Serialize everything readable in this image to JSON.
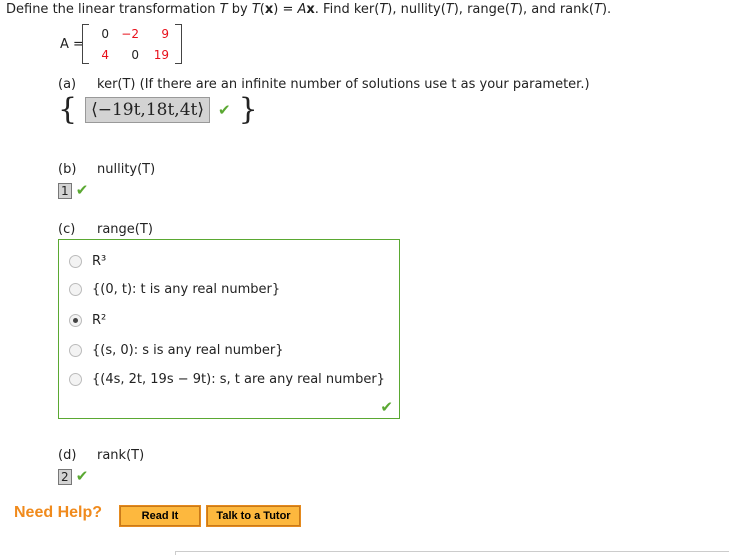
{
  "question": {
    "prefix": "Define the linear transformation ",
    "T": "T",
    "by": " by ",
    "Tx": "T",
    "x": "x",
    "eq": ") = ",
    "A": "A",
    "x2": "x",
    "rest": ". Find ker(T), nullity(T), range(T), and rank(T)."
  },
  "matrix": {
    "label": "A =",
    "rows": [
      [
        "0",
        "−2",
        "9"
      ],
      [
        "4",
        "0",
        "19"
      ]
    ]
  },
  "part_a": {
    "label": "(a)",
    "text": "ker(T) (If there are an infinite number of solutions use t as your parameter.)",
    "answer": "⟨−19t,18t,4t⟩"
  },
  "part_b": {
    "label": "(b)",
    "text": "nullity(T)",
    "answer": "1"
  },
  "part_c": {
    "label": "(c)",
    "text": "range(T)",
    "options": [
      "R³",
      "{(0, t): t is any real number}",
      "R²",
      "{(s, 0): s is any real number}",
      "{(4s, 2t, 19s − 9t): s, t are any real number}"
    ],
    "selected": 2
  },
  "part_d": {
    "label": "(d)",
    "text": "rank(T)",
    "answer": "2"
  },
  "help": {
    "label": "Need Help?",
    "read_it": "Read It",
    "tutor": "Talk to a Tutor"
  }
}
